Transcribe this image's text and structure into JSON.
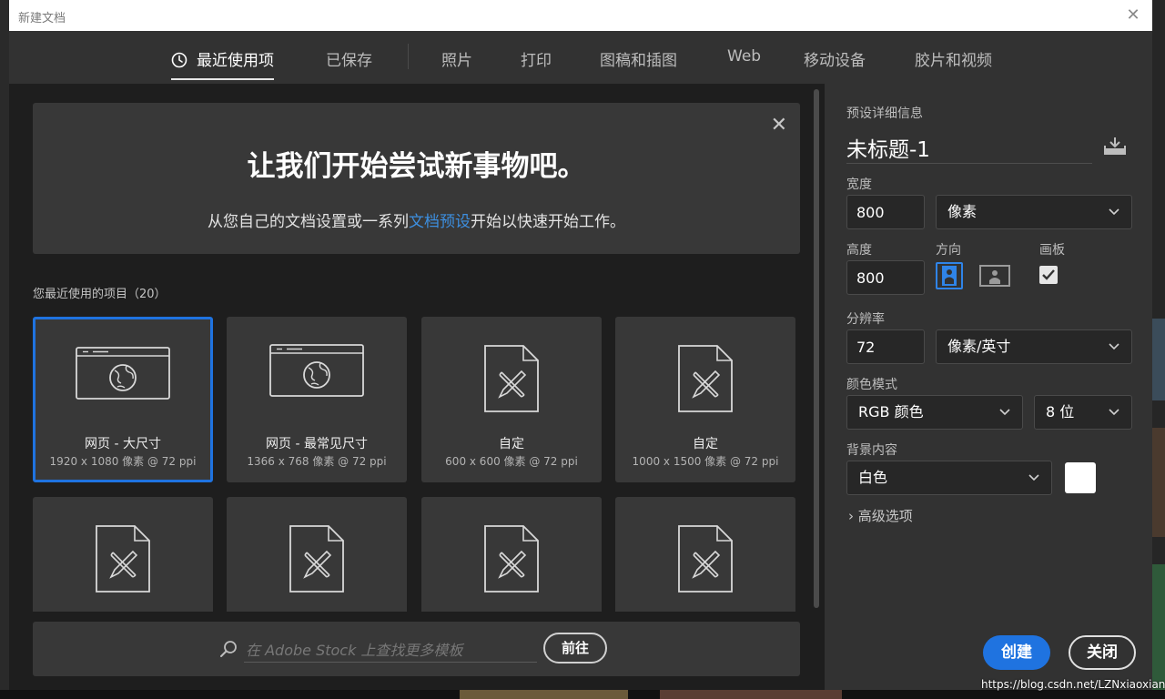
{
  "window": {
    "title": "新建文档"
  },
  "tabs": [
    {
      "label": "最近使用项",
      "active": true
    },
    {
      "label": "已保存"
    },
    {
      "label": "照片"
    },
    {
      "label": "打印"
    },
    {
      "label": "图稿和插图"
    },
    {
      "label": "Web"
    },
    {
      "label": "移动设备"
    },
    {
      "label": "胶片和视频"
    }
  ],
  "welcome": {
    "heading": "让我们开始尝试新事物吧。",
    "sub_before": "从您自己的文档设置或一系列",
    "sub_link": "文档预设",
    "sub_after": "开始以快速开始工作。"
  },
  "recent": {
    "label": "您最近使用的项目",
    "count": "（20）",
    "items": [
      {
        "name": "网页 - 大尺寸",
        "meta": "1920 x 1080 像素 @ 72 ppi",
        "icon": "web-globe-icon",
        "selected": true
      },
      {
        "name": "网页 - 最常见尺寸",
        "meta": "1366 x 768 像素 @ 72 ppi",
        "icon": "web-globe-icon"
      },
      {
        "name": "自定",
        "meta": "600 x 600 像素 @ 72 ppi",
        "icon": "custom-doc-icon"
      },
      {
        "name": "自定",
        "meta": "1000 x 1500 像素 @ 72 ppi",
        "icon": "custom-doc-icon"
      },
      {
        "name": "",
        "meta": "",
        "icon": "custom-doc-icon"
      },
      {
        "name": "",
        "meta": "",
        "icon": "custom-doc-icon"
      },
      {
        "name": "",
        "meta": "",
        "icon": "custom-doc-icon"
      },
      {
        "name": "",
        "meta": "",
        "icon": "custom-doc-icon"
      }
    ]
  },
  "stock": {
    "placeholder": "在 Adobe Stock 上查找更多模板",
    "go_label": "前往"
  },
  "preset": {
    "section_label": "预设详细信息",
    "doc_name": "未标题-1",
    "width_label": "宽度",
    "width_value": "800",
    "width_unit": "像素",
    "height_label": "高度",
    "height_value": "800",
    "orientation_label": "方向",
    "artboard_label": "画板",
    "artboard_checked": true,
    "resolution_label": "分辨率",
    "resolution_value": "72",
    "resolution_unit": "像素/英寸",
    "color_mode_label": "颜色模式",
    "color_mode_value": "RGB 颜色",
    "bit_depth_value": "8 位",
    "bg_label": "背景内容",
    "bg_value": "白色",
    "bg_swatch_color": "#ffffff",
    "advanced_label": "高级选项"
  },
  "actions": {
    "create_label": "创建",
    "close_label": "关闭"
  },
  "watermark": "https://blog.csdn.net/LZNxiaoxiang",
  "colors": {
    "accent": "#1f73e0",
    "link": "#3d8fe0"
  }
}
